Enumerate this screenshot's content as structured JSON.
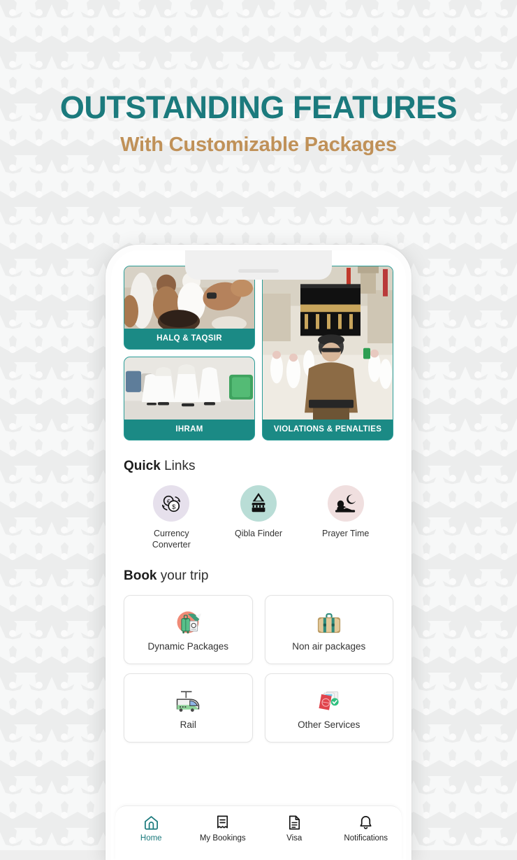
{
  "header": {
    "title": "OUTSTANDING FEATURES",
    "subtitle": "With Customizable Packages",
    "title_color": "#1b7a7d",
    "subtitle_color": "#c09158"
  },
  "theme": {
    "accent_teal": "#1b8a85",
    "page_background": "#eceded",
    "phone_frame": "#fdfdfd"
  },
  "phone": {
    "features": [
      {
        "label": "HALQ & TAQSIR",
        "icon": "halq-taqsir-photo"
      },
      {
        "label": "IHRAM",
        "icon": "ihram-photo"
      },
      {
        "label": "VIOLATIONS & PENALTIES",
        "icon": "violations-penalties-photo"
      }
    ],
    "quick_links": {
      "title_bold": "Quick",
      "title_rest": " Links",
      "items": [
        {
          "label": "Currency Converter",
          "icon": "currency-converter-icon",
          "circle_color": "#e6e0ec"
        },
        {
          "label": "Qibla Finder",
          "icon": "qibla-finder-icon",
          "circle_color": "#b9ddd6"
        },
        {
          "label": "Prayer Time",
          "icon": "prayer-time-icon",
          "circle_color": "#f0dfdf"
        }
      ]
    },
    "book_trip": {
      "title_bold": "Book",
      "title_rest": " your trip",
      "items": [
        {
          "label": "Dynamic Packages",
          "icon": "dynamic-packages-icon"
        },
        {
          "label": "Non air packages",
          "icon": "non-air-packages-icon"
        },
        {
          "label": "Rail",
          "icon": "rail-icon"
        },
        {
          "label": "Other Services",
          "icon": "other-services-icon"
        }
      ]
    },
    "bottom_nav": {
      "active_index": 0,
      "active_color": "#1b7a7d",
      "items": [
        {
          "label": "Home",
          "icon": "home-icon"
        },
        {
          "label": "My Bookings",
          "icon": "receipt-icon"
        },
        {
          "label": "Visa",
          "icon": "document-icon"
        },
        {
          "label": "Notifications",
          "icon": "bell-icon"
        }
      ]
    }
  }
}
